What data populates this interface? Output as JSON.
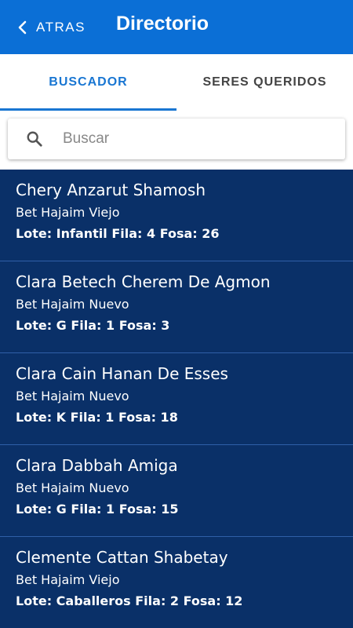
{
  "header": {
    "back_label": "ATRAS",
    "title": "Directorio",
    "background_color": "#0b6fd6",
    "back_icon": "chevron-left-icon"
  },
  "tabs": [
    {
      "label": "BUSCADOR",
      "active": true
    },
    {
      "label": "SERES QUERIDOS",
      "active": false
    }
  ],
  "search": {
    "placeholder": "Buscar",
    "value": "",
    "icon": "search-icon"
  },
  "results": {
    "background_color": "#0a3068",
    "items": [
      {
        "name": "Chery Anzarut Shamosh",
        "cemetery": "Bet Hajaim Viejo",
        "location": "Lote: Infantil Fila: 4 Fosa: 26"
      },
      {
        "name": "Clara Betech Cherem De Agmon",
        "cemetery": "Bet Hajaim Nuevo",
        "location": "Lote: G Fila: 1 Fosa: 3"
      },
      {
        "name": "Clara Cain Hanan De Esses",
        "cemetery": "Bet Hajaim Nuevo",
        "location": "Lote: K Fila: 1 Fosa: 18"
      },
      {
        "name": "Clara Dabbah Amiga",
        "cemetery": "Bet Hajaim Nuevo",
        "location": "Lote: G Fila: 1 Fosa: 15"
      },
      {
        "name": "Clemente Cattan Shabetay",
        "cemetery": "Bet Hajaim Viejo",
        "location": "Lote: Caballeros Fila: 2 Fosa: 12"
      }
    ]
  },
  "colors": {
    "accent": "#1976d2",
    "divider": "#2f5fa8"
  }
}
